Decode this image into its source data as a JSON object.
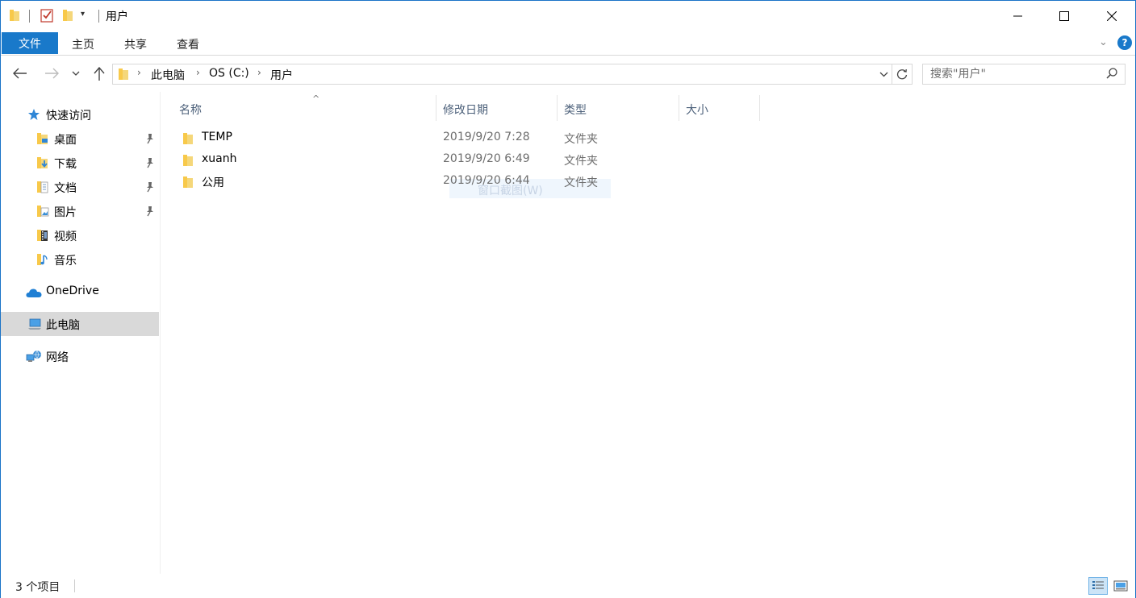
{
  "window": {
    "title": "用户",
    "controls": {
      "minimize": "—",
      "maximize": "☐",
      "close": "✕"
    }
  },
  "ribbon": {
    "tabs": [
      {
        "label": "文件"
      },
      {
        "label": "主页"
      },
      {
        "label": "共享"
      },
      {
        "label": "查看"
      }
    ],
    "help": "?"
  },
  "navigation": {
    "breadcrumbs": [
      "此电脑",
      "OS (C:)",
      "用户"
    ],
    "search_placeholder": "搜索\"用户\""
  },
  "sidebar": {
    "items": [
      {
        "label": "快速访问",
        "icon": "star-icon"
      },
      {
        "label": "桌面",
        "icon": "desktop-folder-icon",
        "pinned": true
      },
      {
        "label": "下载",
        "icon": "downloads-folder-icon",
        "pinned": true
      },
      {
        "label": "文档",
        "icon": "documents-folder-icon",
        "pinned": true
      },
      {
        "label": "图片",
        "icon": "pictures-folder-icon",
        "pinned": true
      },
      {
        "label": "视频",
        "icon": "videos-folder-icon"
      },
      {
        "label": "音乐",
        "icon": "music-folder-icon"
      },
      {
        "label": "OneDrive",
        "icon": "onedrive-cloud-icon"
      },
      {
        "label": "此电脑",
        "icon": "computer-icon",
        "selected": true
      },
      {
        "label": "网络",
        "icon": "network-icon"
      }
    ]
  },
  "columns": {
    "name": "名称",
    "date": "修改日期",
    "type": "类型",
    "size": "大小"
  },
  "files": [
    {
      "name": "TEMP",
      "date": "2019/9/20 7:28",
      "type": "文件夹"
    },
    {
      "name": "xuanh",
      "date": "2019/9/20 6:49",
      "type": "文件夹"
    },
    {
      "name": "公用",
      "date": "2019/9/20 6:44",
      "type": "文件夹"
    }
  ],
  "ghost_tooltip": "窗口截图(W)",
  "status": {
    "item_count": "3 个项目"
  },
  "colors": {
    "accent": "#1979ca",
    "folder": "#f8c94a",
    "selection": "#d9d9d9"
  }
}
